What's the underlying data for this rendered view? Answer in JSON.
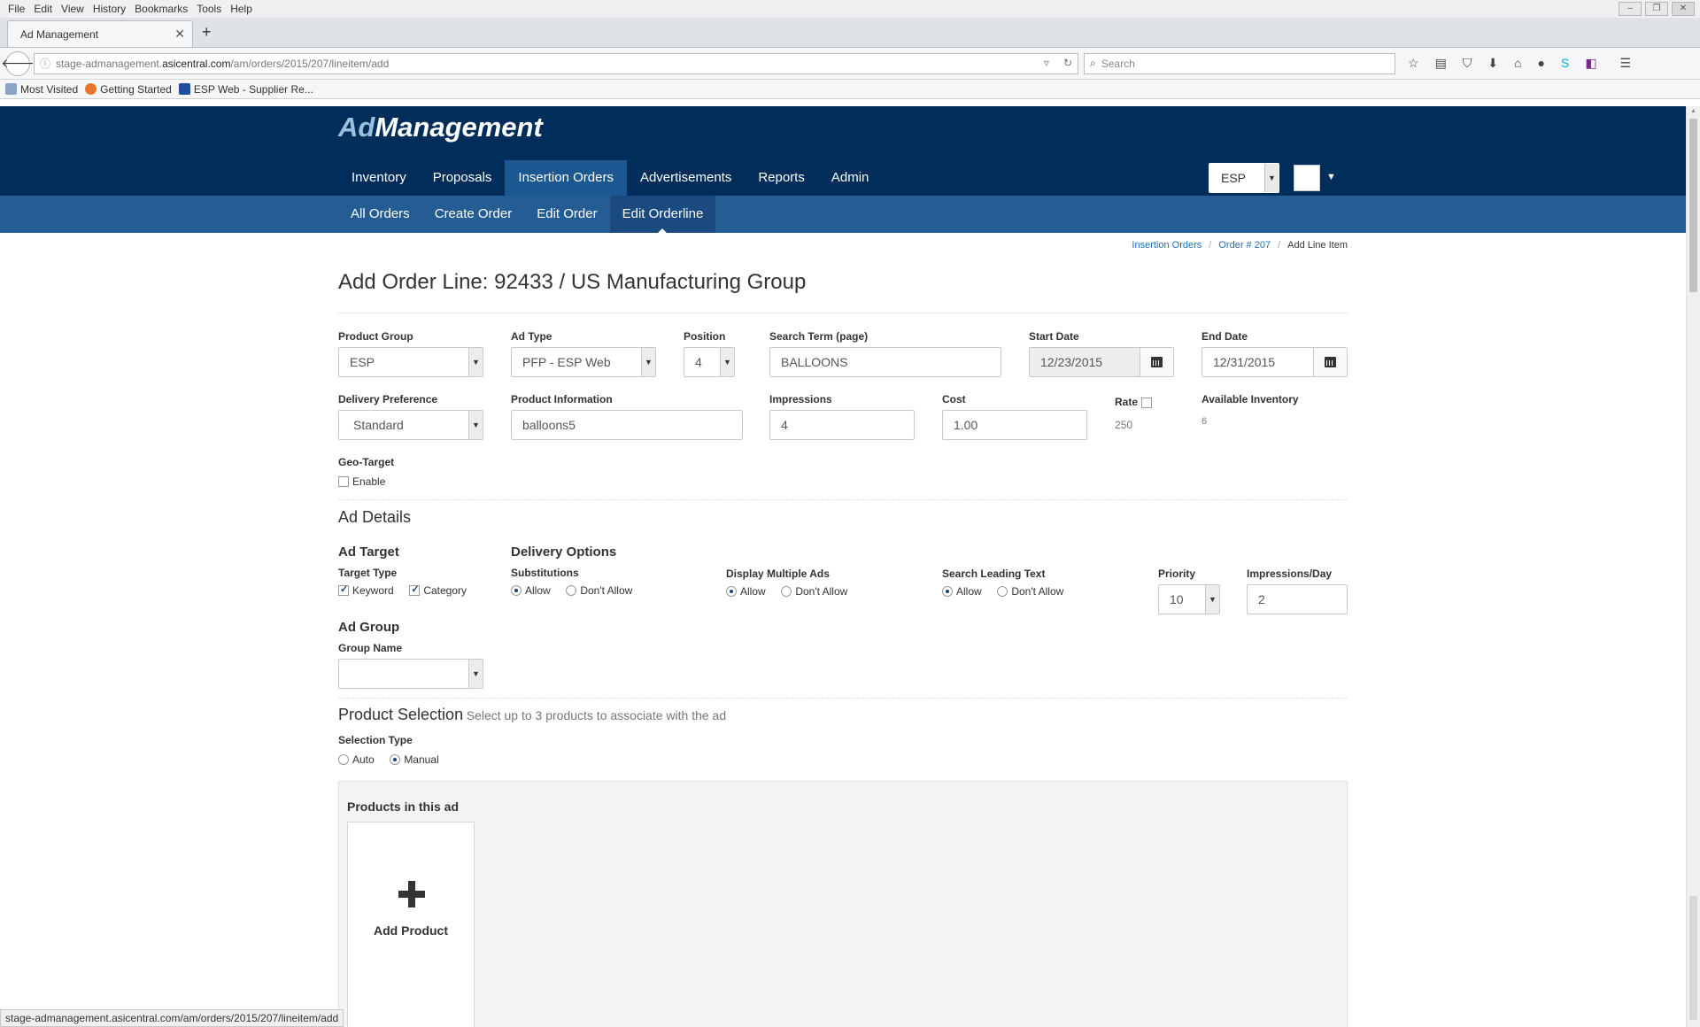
{
  "browser": {
    "menu": [
      "File",
      "Edit",
      "View",
      "History",
      "Bookmarks",
      "Tools",
      "Help"
    ],
    "tab_title": "Ad Management",
    "url_prefix": "stage-admanagement.",
    "url_host": "asicentral.com",
    "url_path": "/am/orders/2015/207/lineitem/add",
    "search_placeholder": "Search",
    "bookmarks": [
      "Most Visited",
      "Getting Started",
      "ESP Web - Supplier Re..."
    ],
    "status_url": "stage-admanagement.asicentral.com/am/orders/2015/207/lineitem/add"
  },
  "app": {
    "logo_ad": "Ad",
    "logo_rest": "Management",
    "nav": [
      "Inventory",
      "Proposals",
      "Insertion Orders",
      "Advertisements",
      "Reports",
      "Admin"
    ],
    "nav_active": "Insertion Orders",
    "org_select": "ESP",
    "subnav": [
      "All Orders",
      "Create Order",
      "Edit Order",
      "Edit Orderline"
    ],
    "subnav_active": "Edit Orderline"
  },
  "breadcrumb": [
    "Insertion Orders",
    "Order # 207",
    "Add Line Item"
  ],
  "page_title": "Add Order Line: 92433 / US Manufacturing Group",
  "form": {
    "product_group": {
      "label": "Product Group",
      "value": "ESP"
    },
    "ad_type": {
      "label": "Ad Type",
      "value": "PFP - ESP Web"
    },
    "position": {
      "label": "Position",
      "value": "4"
    },
    "search_term": {
      "label": "Search Term (page)",
      "value": "BALLOONS"
    },
    "start_date": {
      "label": "Start Date",
      "value": "12/23/2015"
    },
    "end_date": {
      "label": "End Date",
      "value": "12/31/2015"
    },
    "delivery_preference": {
      "label": "Delivery Preference",
      "value": "Standard"
    },
    "product_information": {
      "label": "Product Information",
      "value": "balloons5"
    },
    "impressions": {
      "label": "Impressions",
      "value": "4"
    },
    "cost": {
      "label": "Cost",
      "value": "1.00"
    },
    "rate": {
      "label": "Rate",
      "value": "250",
      "checked": false
    },
    "available_inventory": {
      "label": "Available Inventory",
      "value": "6"
    },
    "geo_target": {
      "label": "Geo-Target",
      "option": "Enable",
      "checked": false
    }
  },
  "ad_details": {
    "title": "Ad Details",
    "ad_target": {
      "title": "Ad Target",
      "label": "Target Type",
      "options": [
        "Keyword",
        "Category"
      ]
    },
    "delivery_options": {
      "title": "Delivery Options",
      "substitutions": {
        "label": "Substitutions",
        "options": [
          "Allow",
          "Don't Allow"
        ],
        "selected": "Allow"
      },
      "display_multiple": {
        "label": "Display Multiple Ads",
        "options": [
          "Allow",
          "Don't Allow"
        ],
        "selected": "Allow"
      },
      "search_leading": {
        "label": "Search Leading Text",
        "options": [
          "Allow",
          "Don't Allow"
        ],
        "selected": "Allow"
      }
    },
    "priority": {
      "label": "Priority",
      "value": "10"
    },
    "impressions_day": {
      "label": "Impressions/Day",
      "value": "2"
    },
    "ad_group": {
      "title": "Ad Group",
      "label": "Group Name",
      "value": ""
    }
  },
  "product_selection": {
    "title": "Product Selection",
    "hint": "Select up to 3 products to associate with the ad",
    "selection_type": {
      "label": "Selection Type",
      "options": [
        "Auto",
        "Manual"
      ],
      "selected": "Manual"
    },
    "panel_title": "Products in this ad",
    "add_label": "Add Product"
  }
}
